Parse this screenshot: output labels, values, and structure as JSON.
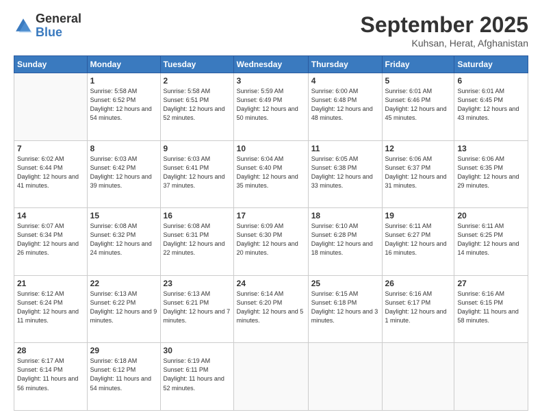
{
  "logo": {
    "general": "General",
    "blue": "Blue"
  },
  "header": {
    "title": "September 2025",
    "location": "Kuhsan, Herat, Afghanistan"
  },
  "days_header": [
    "Sunday",
    "Monday",
    "Tuesday",
    "Wednesday",
    "Thursday",
    "Friday",
    "Saturday"
  ],
  "weeks": [
    [
      {
        "num": "",
        "empty": true
      },
      {
        "num": "1",
        "rise": "5:58 AM",
        "set": "6:52 PM",
        "daylight": "12 hours and 54 minutes."
      },
      {
        "num": "2",
        "rise": "5:58 AM",
        "set": "6:51 PM",
        "daylight": "12 hours and 52 minutes."
      },
      {
        "num": "3",
        "rise": "5:59 AM",
        "set": "6:49 PM",
        "daylight": "12 hours and 50 minutes."
      },
      {
        "num": "4",
        "rise": "6:00 AM",
        "set": "6:48 PM",
        "daylight": "12 hours and 48 minutes."
      },
      {
        "num": "5",
        "rise": "6:01 AM",
        "set": "6:46 PM",
        "daylight": "12 hours and 45 minutes."
      },
      {
        "num": "6",
        "rise": "6:01 AM",
        "set": "6:45 PM",
        "daylight": "12 hours and 43 minutes."
      }
    ],
    [
      {
        "num": "7",
        "rise": "6:02 AM",
        "set": "6:44 PM",
        "daylight": "12 hours and 41 minutes."
      },
      {
        "num": "8",
        "rise": "6:03 AM",
        "set": "6:42 PM",
        "daylight": "12 hours and 39 minutes."
      },
      {
        "num": "9",
        "rise": "6:03 AM",
        "set": "6:41 PM",
        "daylight": "12 hours and 37 minutes."
      },
      {
        "num": "10",
        "rise": "6:04 AM",
        "set": "6:40 PM",
        "daylight": "12 hours and 35 minutes."
      },
      {
        "num": "11",
        "rise": "6:05 AM",
        "set": "6:38 PM",
        "daylight": "12 hours and 33 minutes."
      },
      {
        "num": "12",
        "rise": "6:06 AM",
        "set": "6:37 PM",
        "daylight": "12 hours and 31 minutes."
      },
      {
        "num": "13",
        "rise": "6:06 AM",
        "set": "6:35 PM",
        "daylight": "12 hours and 29 minutes."
      }
    ],
    [
      {
        "num": "14",
        "rise": "6:07 AM",
        "set": "6:34 PM",
        "daylight": "12 hours and 26 minutes."
      },
      {
        "num": "15",
        "rise": "6:08 AM",
        "set": "6:32 PM",
        "daylight": "12 hours and 24 minutes."
      },
      {
        "num": "16",
        "rise": "6:08 AM",
        "set": "6:31 PM",
        "daylight": "12 hours and 22 minutes."
      },
      {
        "num": "17",
        "rise": "6:09 AM",
        "set": "6:30 PM",
        "daylight": "12 hours and 20 minutes."
      },
      {
        "num": "18",
        "rise": "6:10 AM",
        "set": "6:28 PM",
        "daylight": "12 hours and 18 minutes."
      },
      {
        "num": "19",
        "rise": "6:11 AM",
        "set": "6:27 PM",
        "daylight": "12 hours and 16 minutes."
      },
      {
        "num": "20",
        "rise": "6:11 AM",
        "set": "6:25 PM",
        "daylight": "12 hours and 14 minutes."
      }
    ],
    [
      {
        "num": "21",
        "rise": "6:12 AM",
        "set": "6:24 PM",
        "daylight": "12 hours and 11 minutes."
      },
      {
        "num": "22",
        "rise": "6:13 AM",
        "set": "6:22 PM",
        "daylight": "12 hours and 9 minutes."
      },
      {
        "num": "23",
        "rise": "6:13 AM",
        "set": "6:21 PM",
        "daylight": "12 hours and 7 minutes."
      },
      {
        "num": "24",
        "rise": "6:14 AM",
        "set": "6:20 PM",
        "daylight": "12 hours and 5 minutes."
      },
      {
        "num": "25",
        "rise": "6:15 AM",
        "set": "6:18 PM",
        "daylight": "12 hours and 3 minutes."
      },
      {
        "num": "26",
        "rise": "6:16 AM",
        "set": "6:17 PM",
        "daylight": "12 hours and 1 minute."
      },
      {
        "num": "27",
        "rise": "6:16 AM",
        "set": "6:15 PM",
        "daylight": "11 hours and 58 minutes."
      }
    ],
    [
      {
        "num": "28",
        "rise": "6:17 AM",
        "set": "6:14 PM",
        "daylight": "11 hours and 56 minutes."
      },
      {
        "num": "29",
        "rise": "6:18 AM",
        "set": "6:12 PM",
        "daylight": "11 hours and 54 minutes."
      },
      {
        "num": "30",
        "rise": "6:19 AM",
        "set": "6:11 PM",
        "daylight": "11 hours and 52 minutes."
      },
      {
        "num": "",
        "empty": true
      },
      {
        "num": "",
        "empty": true
      },
      {
        "num": "",
        "empty": true
      },
      {
        "num": "",
        "empty": true
      }
    ]
  ]
}
